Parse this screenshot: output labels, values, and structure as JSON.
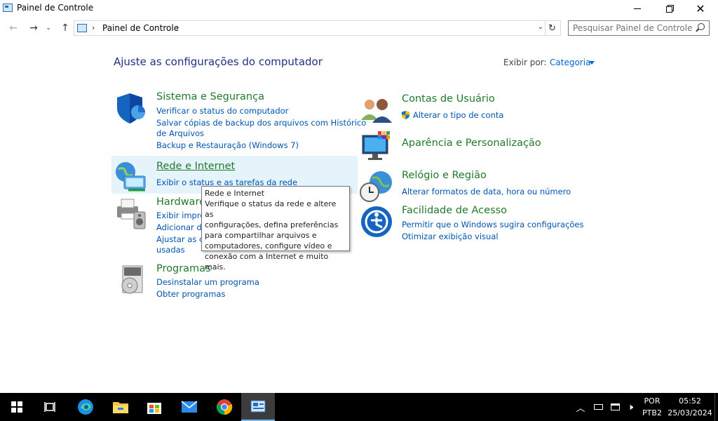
{
  "window": {
    "title": "Painel de Controle",
    "minimize_icon": "minimize-icon",
    "maximize_icon": "restore-icon",
    "close_icon": "close-icon"
  },
  "addressbar": {
    "crumb": "Painel de Controle",
    "search_placeholder": "Pesquisar Painel de Controle"
  },
  "main": {
    "heading": "Ajuste as configurações do computador",
    "view_by_label": "Exibir por:",
    "view_by_value": "Categoria"
  },
  "categories": {
    "sistema": {
      "title": "Sistema e Segurança",
      "links": [
        "Verificar o status do computador",
        "Salvar cópias de backup dos arquivos com Histórico",
        "de Arquivos",
        "Backup e Restauração (Windows 7)"
      ]
    },
    "rede": {
      "title": "Rede e Internet",
      "links": [
        "Exibir o status e as tarefas da rede"
      ]
    },
    "hardware": {
      "title": "Hardware",
      "links": [
        "Exibir impre",
        "Adicionar di",
        "Ajustar as co",
        "usadas"
      ]
    },
    "programas": {
      "title": "Programas",
      "links": [
        "Desinstalar um programa",
        "Obter programas"
      ]
    },
    "contas": {
      "title": "Contas de Usuário",
      "links": [
        "Alterar o tipo de conta"
      ]
    },
    "aparencia": {
      "title": "Aparência e Personalização",
      "links": []
    },
    "relogio": {
      "title": "Relógio e Região",
      "links": [
        "Alterar formatos de data, hora ou número"
      ]
    },
    "facilidade": {
      "title": "Facilidade de Acesso",
      "links": [
        "Permitir que o Windows sugira configurações",
        "Otimizar exibição visual"
      ]
    }
  },
  "tooltip": {
    "title": "Rede e Internet",
    "lines": [
      "Verifique o status da rede e altere as",
      "configurações, defina preferências",
      "para compartilhar arquivos e",
      "computadores, configure vídeo e",
      "conexão com a Internet e muito mais."
    ]
  },
  "taskbar": {
    "apps": [
      "start-icon",
      "task-view-icon",
      "edge-icon",
      "file-explorer-icon",
      "store-icon",
      "mail-icon",
      "chrome-icon",
      "control-panel-icon"
    ],
    "lang_top": "POR",
    "lang_bottom": "PTB2",
    "time": "05:52",
    "date": "25/03/2024"
  },
  "colors": {
    "category_title": "#217a2c",
    "link": "#0055b0",
    "heading": "#1e3287",
    "hover_bg": "#e5f3fb"
  }
}
